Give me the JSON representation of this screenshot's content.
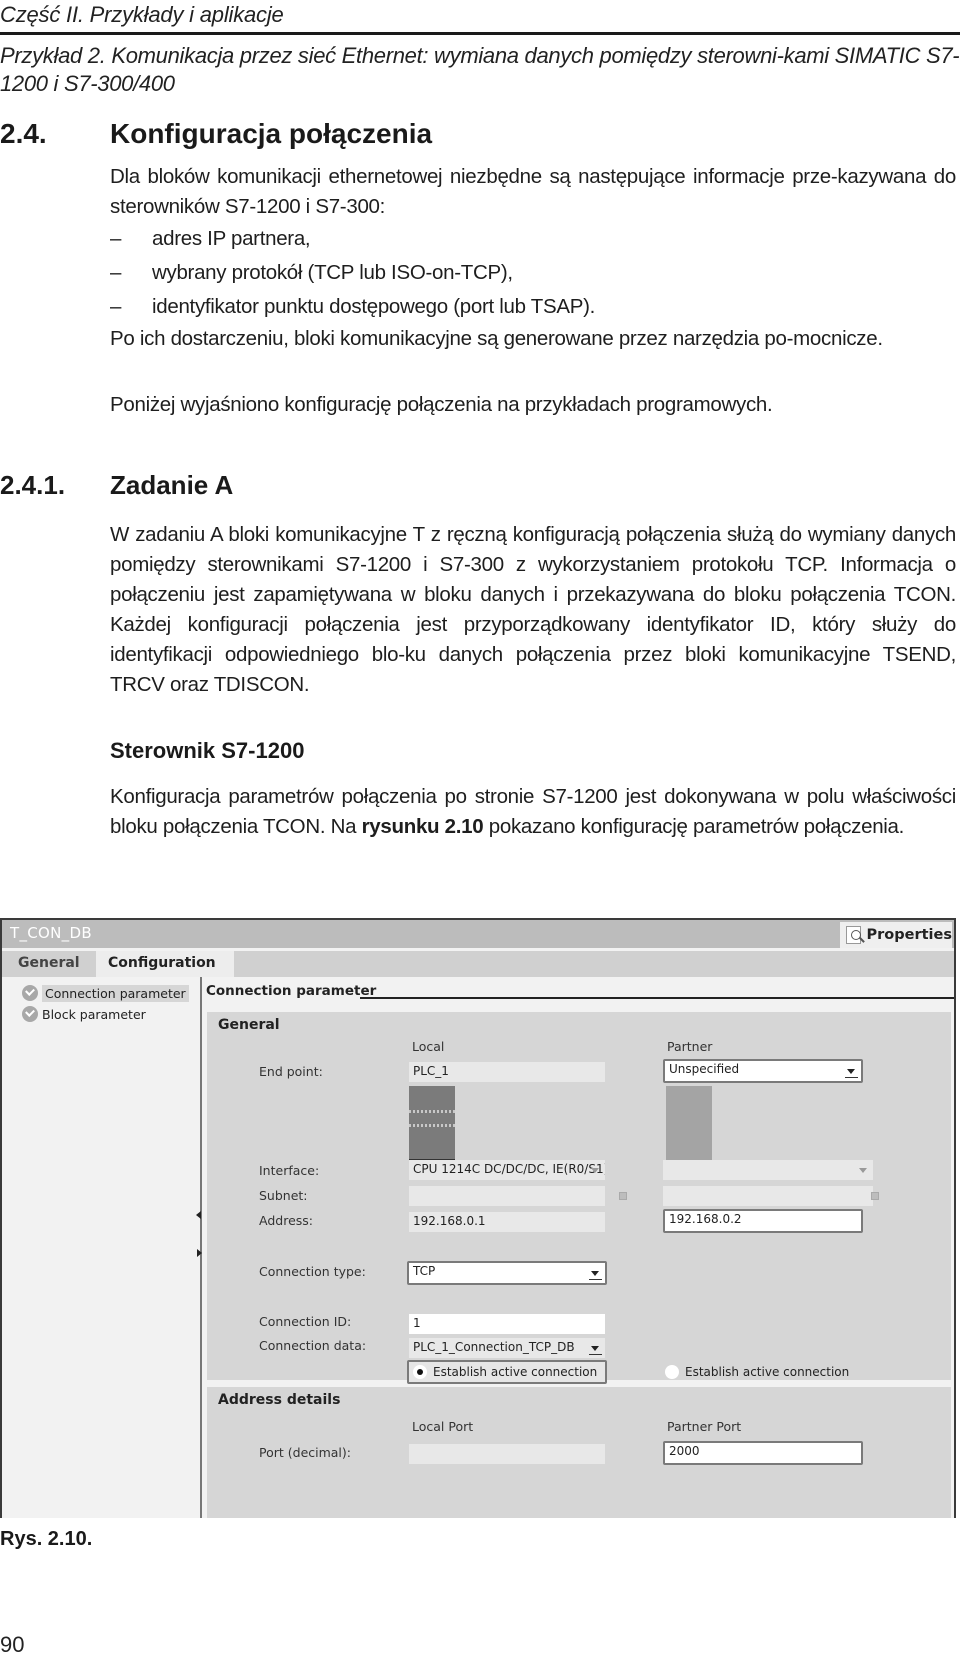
{
  "running_head": "Część II. Przykłady i aplikacje",
  "subhead": "Przykład 2. Komunikacja przez sieć Ethernet: wymiana danych pomiędzy sterowni-kami SIMATIC S7-1200 i S7-300/400",
  "section": {
    "number": "2.4.",
    "title": "Konfiguracja połączenia",
    "intro": "Dla bloków komunikacji ethernetowej niezbędne są następujące informacje prze-kazywana do sterowników S7-1200 i S7-300:",
    "list": [
      "adres IP partnera,",
      "wybrany protokół (TCP lub ISO-on-TCP),",
      "identyfikator punktu dostępowego (port lub TSAP)."
    ],
    "list_marker": "–",
    "para2": "Po ich dostarczeniu, bloki komunikacyjne są generowane przez narzędzia po-mocnicze.",
    "para3": "Poniżej wyjaśniono konfigurację połączenia na przykładach programowych."
  },
  "subsection": {
    "number": "2.4.1.",
    "title": "Zadanie A",
    "para": "W zadaniu A bloki komunikacyjne T z ręczną konfiguracją połączenia służą do wymiany danych pomiędzy sterownikami S7-1200 i S7-300 z wykorzystaniem protokołu TCP. Informacja o połączeniu jest zapamiętywana w bloku danych i przekazywana do bloku połączenia TCON. Każdej konfiguracji połączenia jest przyporządkowany identyfikator ID, który służy do identyfikacji odpowiedniego blo-ku danych połączenia przez bloki komunikacyjne TSEND, TRCV oraz TDISCON."
  },
  "controller": {
    "heading": "Sterownik S7-1200",
    "para_part1": "Konfiguracja parametrów połączenia po stronie S7-1200 jest dokonywana w polu właściwości bloku połączenia TCON. Na ",
    "para_bold": "rysunku 2.10",
    "para_part2": " pokazano konfigurację parametrów połączenia."
  },
  "figure": {
    "window_title": "T_CON_DB",
    "properties_label": "Properties",
    "tabs": [
      "General",
      "Configuration"
    ],
    "active_tab": "Configuration",
    "nav_items": [
      "Connection parameter",
      "Block parameter"
    ],
    "section_title": "Connection parameter",
    "general": {
      "title": "General",
      "col_local": "Local",
      "col_partner": "Partner",
      "end_point_label": "End point:",
      "local_end_point": "PLC_1",
      "partner_end_point": "Unspecified",
      "interface_label": "Interface:",
      "local_interface": "CPU 1214C DC/DC/DC, IE(R0/S1)",
      "partner_interface": "",
      "subnet_label": "Subnet:",
      "local_subnet": "",
      "partner_subnet": "",
      "address_label": "Address:",
      "local_address": "192.168.0.1",
      "partner_address": "192.168.0.2",
      "connection_type_label": "Connection type:",
      "connection_type": "TCP",
      "connection_id_label": "Connection ID:",
      "connection_id": "1",
      "connection_data_label": "Connection data:",
      "connection_data": "PLC_1_Connection_TCP_DB",
      "local_active_label": "Establish active connection",
      "local_active_selected": true,
      "partner_active_label": "Establish active connection",
      "partner_active_selected": false
    },
    "address_details": {
      "title": "Address details",
      "col_local": "Local Port",
      "col_partner": "Partner Port",
      "port_label": "Port (decimal):",
      "local_port": "",
      "partner_port": "2000"
    }
  },
  "caption": "Rys. 2.10.",
  "page_number": "90"
}
